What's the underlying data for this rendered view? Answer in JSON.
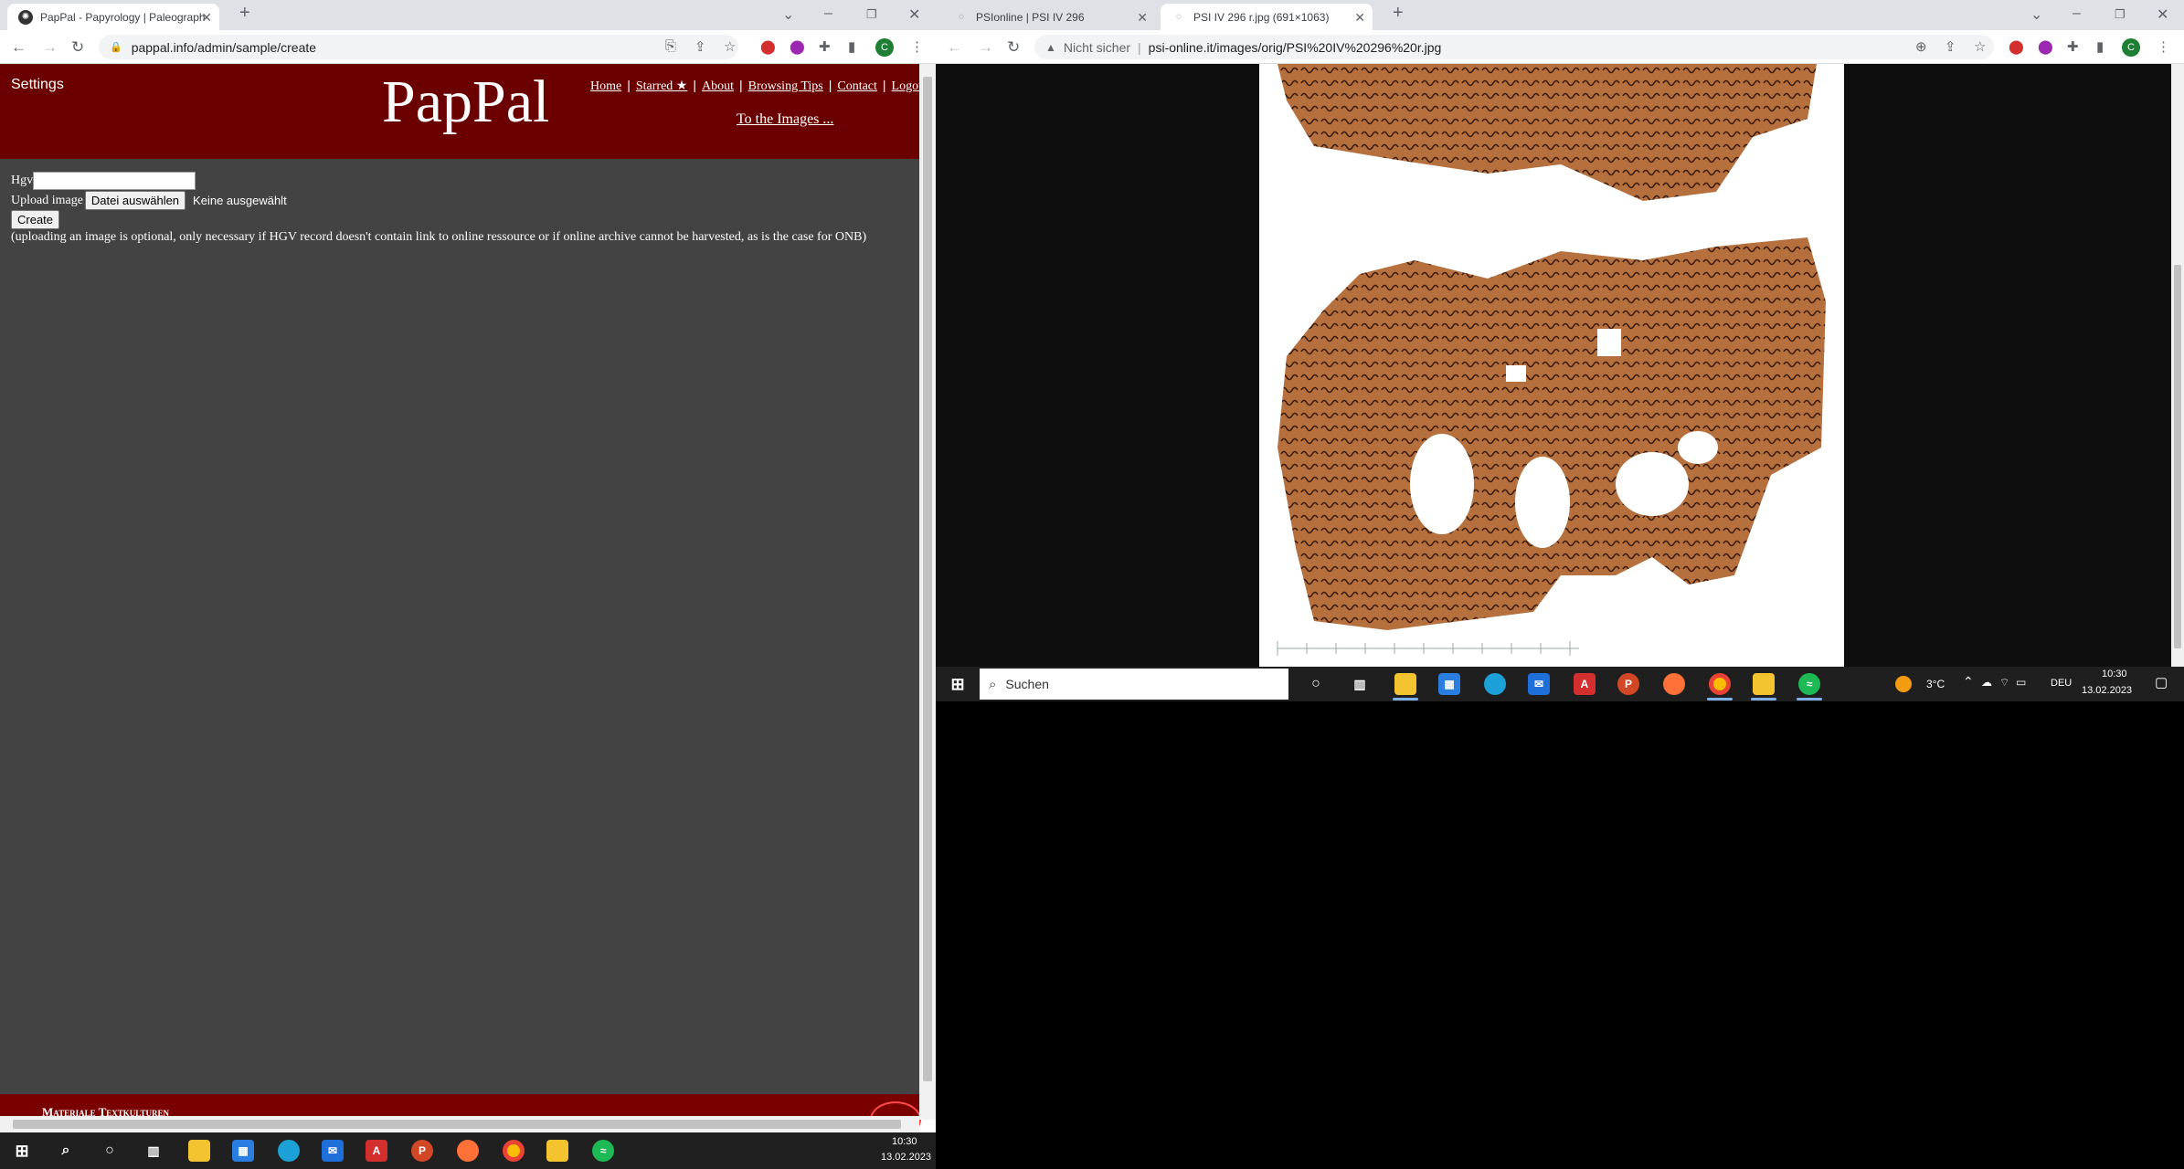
{
  "left_browser": {
    "tabs": [
      {
        "title": "PapPal - Papyrology | Paleograph",
        "active": true
      }
    ],
    "url": "pappal.info/admin/sample/create",
    "profile_initial": "C"
  },
  "right_browser": {
    "tabs": [
      {
        "title": "PSIonline | PSI IV 296",
        "active": false
      },
      {
        "title": "PSI IV 296 r.jpg (691×1063)",
        "active": true
      }
    ],
    "security_label": "Nicht sicher",
    "url": "psi-online.it/images/orig/PSI%20IV%20296%20r.jpg",
    "profile_initial": "C"
  },
  "pappal": {
    "settings": "Settings",
    "logo": "PapPal",
    "nav": [
      "Home",
      "Starred ★",
      "About",
      "Browsing Tips",
      "Contact",
      "Logout"
    ],
    "to_images": "To the Images ...",
    "form": {
      "hgv_label": "Hgv",
      "hgv_value": "",
      "upload_label": "Upload image",
      "file_button": "Datei auswählen",
      "file_status": "Keine ausgewählt",
      "create_button": "Create",
      "note": "(uploading an image is optional, only necessary if HGV record doesn't contain link to online ressource or if online archive cannot be harvested, as is the case for ONB)"
    },
    "footer_text": "Materiale Textkulturen"
  },
  "taskbar_right": {
    "search_placeholder": "Suchen",
    "weather": "3°C",
    "language": "DEU",
    "time": "10:30",
    "date": "13.02.2023"
  },
  "taskbar_left": {
    "time": "10:30",
    "date": "13.02.2023"
  },
  "colors": {
    "pappal_red": "#6b0000",
    "pappal_body": "#434343",
    "chrome_frame": "#dee1e6",
    "taskbar": "#202020"
  }
}
